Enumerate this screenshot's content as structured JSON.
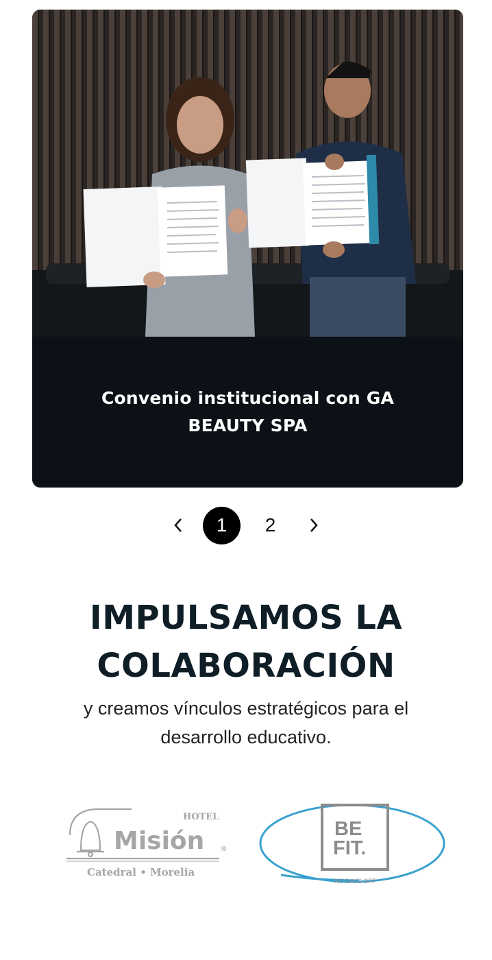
{
  "card": {
    "caption": "Convenio institucional con GA BEAUTY SPA",
    "photo_icon": "photo-two-people-holding-signed-agreement"
  },
  "pager": {
    "prev_icon": "chevron-left-icon",
    "next_icon": "chevron-right-icon",
    "pages": [
      "1",
      "2"
    ],
    "active_page": "1"
  },
  "heading": {
    "line1": "IMPULSAMOS LA",
    "line2": "COLABORACIÓN"
  },
  "subheading": "y creamos vínculos estratégicos para el desarrollo educativo.",
  "partners": [
    {
      "name": "Hotel Misión Catedral Morelia",
      "top": "HOTEL",
      "main": "Misión",
      "sub": "Catedral • Morelia",
      "reg": "®"
    },
    {
      "name": "BE FIT",
      "line1": "BE",
      "line2": "FIT.",
      "tagline": "NO DAYS OFF"
    }
  ],
  "colors": {
    "card_bg": "#0b1116",
    "heading": "#0f1e26",
    "accent_ring": "#3aa1cf",
    "logo_gray": "#9b9b9b"
  }
}
